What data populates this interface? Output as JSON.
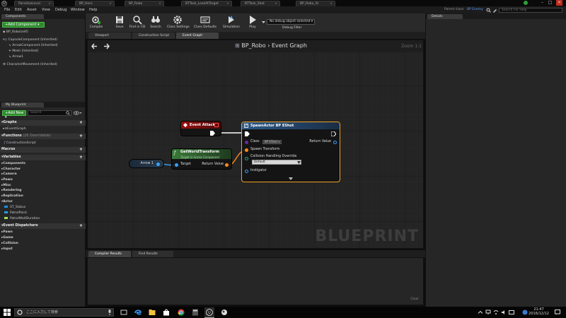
{
  "window": {
    "logo": "U",
    "tabs": [
      {
        "label": "ParadiseLevel",
        "active": false
      },
      {
        "label": "BP_Hero",
        "active": false
      },
      {
        "label": "BP_Robo",
        "active": true
      },
      {
        "label": "BTTask_LookAtTarget",
        "active": false
      },
      {
        "label": "BTTask_Shot",
        "active": false
      },
      {
        "label": "BP_Robo_AI",
        "active": false
      }
    ],
    "tab_close": "×",
    "controls": {
      "minimize": "–",
      "maximize": "□",
      "close": "✕"
    }
  },
  "menu": {
    "items": [
      "File",
      "Edit",
      "Asset",
      "View",
      "Debug",
      "Window",
      "Help"
    ],
    "parent_class_label": "Parent class:",
    "parent_class_value": "BP Enemy",
    "help_search_placeholder": "Search For Help"
  },
  "components": {
    "tab_label": "Components",
    "add_button": "+Add Component ▾",
    "root": "BP_Robo(self)",
    "tree": [
      "CapsuleComponent (Inherited)",
      "ArrowComponent (Inherited)",
      "Mesh (Inherited)",
      "Arrow1",
      "CharacterMovement (Inherited)"
    ]
  },
  "my_blueprint": {
    "tab_label": "My Blueprint",
    "add_button": "+Add New ▾",
    "search_placeholder": "Search",
    "sections": {
      "graphs": "Graphs",
      "graph_item": "EventGraph",
      "functions": "Functions",
      "functions_note": "(26 Overridable)",
      "function_item": "ConstructionScript",
      "macros": "Macros",
      "variables": "Variables",
      "variable_categories": [
        "Components",
        "Character",
        "Camera",
        "Pawn",
        "Misc",
        "Rendering",
        "Replication",
        "Actor"
      ],
      "variables_list": [
        {
          "name": "ST_Status",
          "color": "#1f8ee0"
        },
        {
          "name": "PatrolPoint",
          "color": "#1fa0e0"
        },
        {
          "name": "PatrolWaitDuration",
          "color": "#9fe05a"
        }
      ],
      "event_dispatchers": "Event Dispatchers",
      "dispatcher_categories": [
        "Pawn",
        "Game",
        "Collision",
        "Input"
      ]
    }
  },
  "toolbar": {
    "buttons": [
      "Compile",
      "Save",
      "Find in CB",
      "Search",
      "Class Settings",
      "Class Defaults",
      "Simulation",
      "Play"
    ],
    "debug_select": "No debug object selected ▾",
    "debug_filter": "Debug Filter"
  },
  "graph_tabs": [
    "Viewport",
    "Construction Script",
    "Event Graph"
  ],
  "graph": {
    "breadcrumb_class": "BP_Robo",
    "breadcrumb_sep": "›",
    "breadcrumb_graph": "Event Graph",
    "zoom": "Zoom 1:1",
    "watermark": "BLUEPRINT",
    "nodes": {
      "event": {
        "title": "Event Attack"
      },
      "spawn": {
        "title": "SpawnActor BP EShot",
        "class_label": "Class",
        "class_value": "BP EShot ▾",
        "return_value": "Return Value",
        "spawn_transform": "Spawn Transform",
        "collision": "Collision Handling Override",
        "collision_value": "Default",
        "instigator": "Instigator"
      },
      "transform": {
        "title": "GetWorldTransform",
        "subtitle": "Target is Scene Component",
        "target": "Target",
        "return_value": "Return Value"
      },
      "arrow": {
        "label": "Arrow 1"
      }
    }
  },
  "bottom": {
    "tabs": [
      "Compiler Results",
      "Find Results"
    ],
    "clear": "Clear"
  },
  "details": {
    "tab_label": "Details"
  },
  "taskbar": {
    "search_placeholder": "ここに入力して検索",
    "time": "21:47",
    "date": "2016/12/12"
  }
}
